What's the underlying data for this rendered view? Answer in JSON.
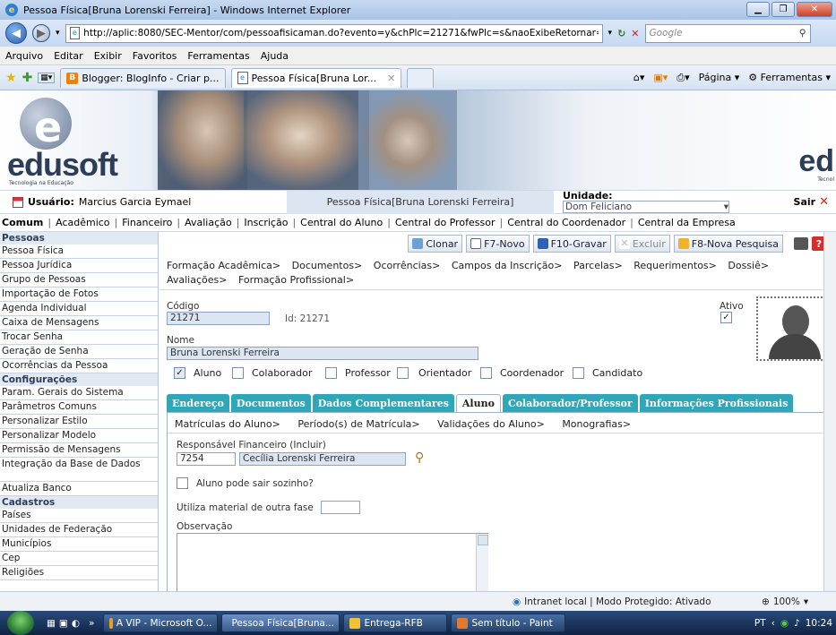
{
  "window": {
    "title": "Pessoa Física[Bruna Lorenski Ferreira] - Windows Internet Explorer"
  },
  "address": {
    "url": "http://aplic:8080/SEC-Mentor/com/pessoafisicaman.do?evento=y&chPlc=21271&fwPlc=s&naoExibeRetornar=S&",
    "search_placeholder": "Google"
  },
  "menu": [
    "Arquivo",
    "Editar",
    "Exibir",
    "Favoritos",
    "Ferramentas",
    "Ajuda"
  ],
  "tabs": [
    {
      "label": "Blogger: BlogInfo - Criar p..."
    },
    {
      "label": "Pessoa Física[Bruna Lor..."
    }
  ],
  "commandbar": {
    "page": "Página",
    "tools": "Ferramentas"
  },
  "banner": {
    "brand": "edusoft",
    "brand_sub": "Tecnologia na Educação",
    "brand_right": "ed",
    "brand_right_sub": "Tecnol"
  },
  "userbar": {
    "user_label": "Usuário:",
    "user_name": "Marcius Garcia Eymael",
    "page_title": "Pessoa Física[Bruna Lorenski Ferreira]",
    "unidade_label": "Unidade:",
    "unidade_value": "Dom Feliciano",
    "sair": "Sair"
  },
  "modules": [
    "Comum",
    "Acadêmico",
    "Financeiro",
    "Avaliação",
    "Inscrição",
    "Central do Aluno",
    "Central do Professor",
    "Central do Coordenador",
    "Central da Empresa"
  ],
  "sidebar": {
    "sections": [
      {
        "title": "Pessoas",
        "items": [
          "Pessoa Física",
          "Pessoa Jurídica",
          "Grupo de Pessoas",
          "Importação de Fotos",
          "Agenda Individual",
          "Caixa de Mensagens",
          "Trocar Senha",
          "Geração de Senha",
          "Ocorrências da Pessoa"
        ]
      },
      {
        "title": "Configurações",
        "items": [
          "Param. Gerais do Sistema",
          "Parâmetros Comuns",
          "Personalizar Estilo",
          "Personalizar Modelo",
          "Permissão de Mensagens",
          "Integração da Base de Dados",
          "Atualiza Banco"
        ]
      },
      {
        "title": "Cadastros",
        "items": [
          "Países",
          "Unidades de Federação",
          "Municípios",
          "Cep",
          "Religiões"
        ]
      }
    ]
  },
  "toolbar": {
    "clonar": "Clonar",
    "novo": "F7-Novo",
    "gravar": "F10-Gravar",
    "excluir": "Excluir",
    "pesquisa": "F8-Nova Pesquisa"
  },
  "links": {
    "row1": [
      "Formação Acadêmica>",
      "Documentos>",
      "Ocorrências>",
      "Campos da Inscrição>",
      "Parcelas>",
      "Requerimentos>",
      "Dossiê>"
    ],
    "row2": [
      "Avaliações>",
      "Formação Profissional>"
    ]
  },
  "form": {
    "codigo_label": "Código",
    "codigo_value": "21271",
    "id_text": "Id: 21271",
    "ativo_label": "Ativo",
    "nome_label": "Nome",
    "nome_value": "Bruna Lorenski Ferreira",
    "roles": [
      {
        "label": "Aluno",
        "checked": true
      },
      {
        "label": "Colaborador",
        "checked": false
      },
      {
        "label": "Professor",
        "checked": false
      },
      {
        "label": "Orientador",
        "checked": false
      },
      {
        "label": "Coordenador",
        "checked": false
      },
      {
        "label": "Candidato",
        "checked": false
      }
    ]
  },
  "form_tabs": [
    "Endereço",
    "Documentos",
    "Dados Complementares",
    "Aluno",
    "Colaborador/Professor",
    "Informações Profissionais"
  ],
  "aluno_tab": {
    "sublinks": [
      "Matrículas do Aluno>",
      "Período(s) de Matrícula>",
      "Validações do Aluno>",
      "Monografias>"
    ],
    "responsavel_label": "Responsável Financeiro",
    "incluir": "(Incluir)",
    "responsavel_code": "7254",
    "responsavel_name": "Cecília Lorenski Ferreira",
    "sair_sozinho": "Aluno pode sair sozinho?",
    "material_label": "Utiliza material de outra fase",
    "material_value": "",
    "observacao_label": "Observação",
    "observacao_value": ""
  },
  "status": {
    "zone": "Intranet local | Modo Protegido: Ativado",
    "zoom": "100%"
  },
  "taskbar": {
    "items": [
      "A VIP - Microsoft O...",
      "Pessoa Física[Bruna...",
      "Entrega-RFB",
      "Sem título - Paint"
    ],
    "lang": "PT",
    "time": "10:24"
  }
}
